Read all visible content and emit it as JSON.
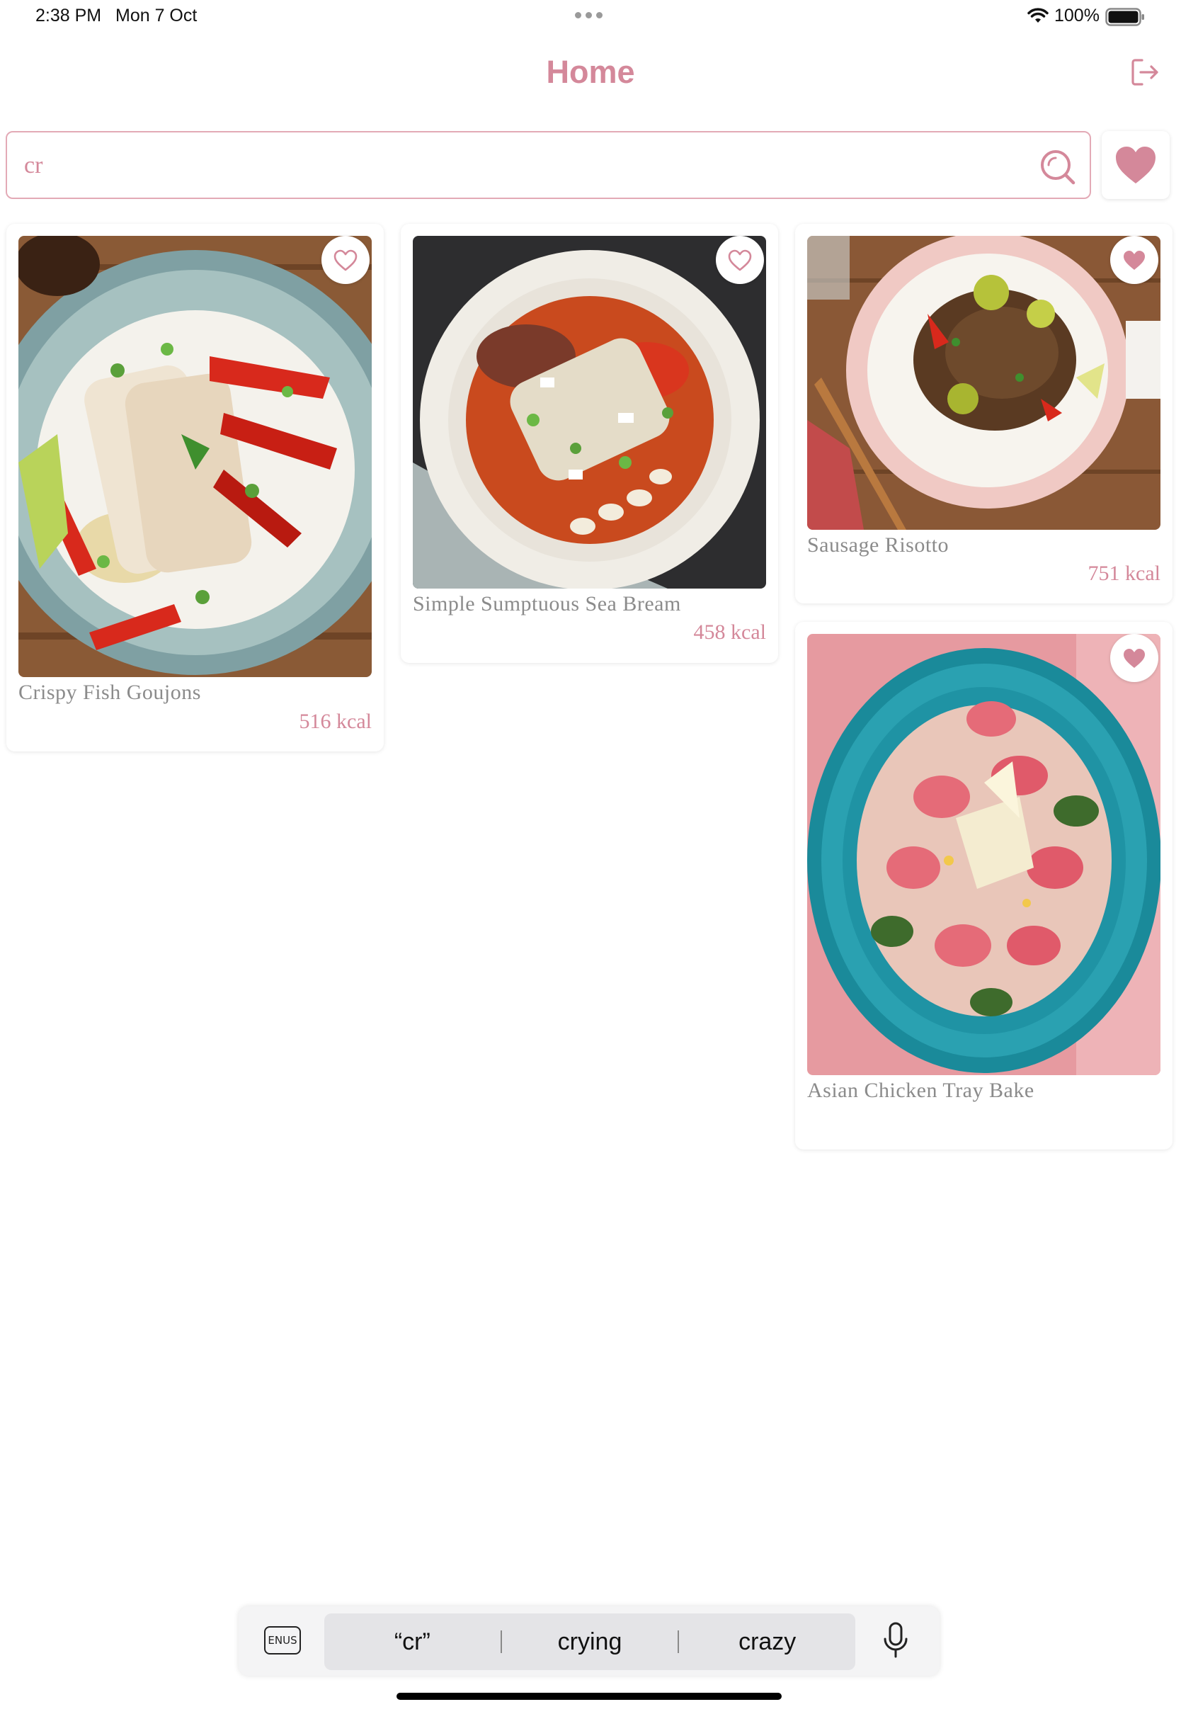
{
  "status": {
    "time": "2:38 PM",
    "date": "Mon 7 Oct",
    "battery": "100%"
  },
  "header": {
    "title": "Home"
  },
  "search": {
    "value": "cr",
    "placeholder": ""
  },
  "recipes": [
    {
      "title": "Crispy Fish Goujons",
      "kcal": "516 kcal",
      "favorite": false
    },
    {
      "title": "Simple Sumptuous Sea Bream",
      "kcal": "458 kcal",
      "favorite": false
    },
    {
      "title": "Sausage Risotto",
      "kcal": "751 kcal",
      "favorite": true
    },
    {
      "title": "Asian Chicken Tray Bake",
      "kcal": "",
      "favorite": true
    }
  ],
  "keyboard": {
    "language": "ENUS",
    "suggestions": [
      "“cr”",
      "crying",
      "crazy"
    ]
  },
  "colors": {
    "accent": "#d4889a",
    "border": "#e3aab6",
    "title_text": "#8b8b8b"
  },
  "icons": {
    "logout": "logout-icon",
    "search": "search-icon",
    "favorites_filter": "heart-filled-icon",
    "favorite_off": "heart-outline-icon",
    "favorite_on": "heart-filled-icon",
    "mic": "microphone-icon"
  }
}
